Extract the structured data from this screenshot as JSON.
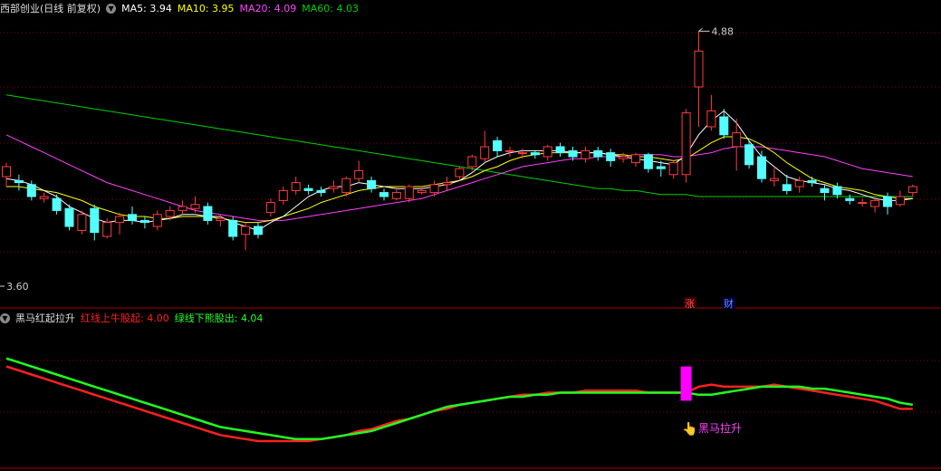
{
  "header1": {
    "title": "西部创业(日线 前复权)",
    "ma5_label": "MA5:",
    "ma5_value": "3.94",
    "ma10_label": "MA10:",
    "ma10_value": "3.95",
    "ma20_label": "MA20:",
    "ma20_value": "4.09",
    "ma60_label": "MA60:",
    "ma60_value": "4.03"
  },
  "header2": {
    "title": "黑马红起拉升",
    "red_label": "红线上牛股起:",
    "red_value": "4.00",
    "green_label": "绿线下熊股出:",
    "green_value": "4.04"
  },
  "annotations": {
    "high_label": "4.88",
    "low_label": "3.60",
    "zhang_badge": "涨",
    "cai_badge": "财",
    "signal_label": "黑马拉升"
  },
  "colors": {
    "up": "#ff3c3c",
    "down": "#54ffff",
    "ma5": "#ffffff",
    "ma10": "#ffff00",
    "ma20": "#ff40ff",
    "ma60": "#00d000",
    "red_line": "#ff2020",
    "green_line": "#20ff20",
    "signal_bar": "#ff00ff",
    "grid": "#8b0000"
  },
  "chart_data": {
    "type": "candlestick",
    "price_range": [
      3.5,
      4.95
    ],
    "high": 4.88,
    "low": 3.6,
    "candles": [
      [
        4.15,
        4.2,
        4.1,
        4.22
      ],
      [
        4.13,
        4.12,
        4.08,
        4.16
      ],
      [
        4.11,
        4.05,
        4.03,
        4.13
      ],
      [
        4.04,
        4.05,
        4.02,
        4.07
      ],
      [
        4.04,
        3.98,
        3.96,
        4.06
      ],
      [
        3.99,
        3.9,
        3.88,
        4.01
      ],
      [
        3.88,
        3.96,
        3.86,
        3.98
      ],
      [
        3.99,
        3.87,
        3.83,
        4.01
      ],
      [
        3.85,
        3.92,
        3.84,
        3.94
      ],
      [
        3.92,
        3.95,
        3.86,
        3.97
      ],
      [
        3.96,
        3.93,
        3.91,
        4.0
      ],
      [
        3.93,
        3.92,
        3.89,
        3.95
      ],
      [
        3.9,
        3.96,
        3.88,
        3.98
      ],
      [
        3.95,
        3.98,
        3.93,
        4.0
      ],
      [
        3.98,
        4.0,
        3.96,
        4.03
      ],
      [
        3.99,
        4.01,
        3.97,
        4.05
      ],
      [
        4.0,
        3.93,
        3.91,
        4.02
      ],
      [
        3.93,
        3.94,
        3.9,
        3.96
      ],
      [
        3.93,
        3.85,
        3.83,
        3.95
      ],
      [
        3.86,
        3.9,
        3.78,
        3.92
      ],
      [
        3.9,
        3.86,
        3.84,
        3.92
      ],
      [
        3.97,
        4.02,
        3.95,
        4.04
      ],
      [
        4.03,
        4.08,
        4.01,
        4.1
      ],
      [
        4.08,
        4.12,
        4.06,
        4.15
      ],
      [
        4.09,
        4.08,
        4.06,
        4.11
      ],
      [
        4.08,
        4.07,
        4.05,
        4.1
      ],
      [
        4.09,
        4.1,
        4.07,
        4.13
      ],
      [
        4.07,
        4.14,
        4.05,
        4.15
      ],
      [
        4.14,
        4.18,
        4.12,
        4.23
      ],
      [
        4.13,
        4.09,
        4.07,
        4.15
      ],
      [
        4.07,
        4.05,
        4.03,
        4.09
      ],
      [
        4.04,
        4.07,
        4.03,
        4.1
      ],
      [
        4.04,
        4.1,
        4.02,
        4.11
      ],
      [
        4.07,
        4.08,
        4.06,
        4.1
      ],
      [
        4.07,
        4.11,
        4.05,
        4.13
      ],
      [
        4.11,
        4.12,
        4.08,
        4.15
      ],
      [
        4.15,
        4.19,
        4.13,
        4.2
      ],
      [
        4.2,
        4.25,
        4.18,
        4.26
      ],
      [
        4.24,
        4.3,
        4.22,
        4.38
      ],
      [
        4.33,
        4.28,
        4.25,
        4.35
      ],
      [
        4.28,
        4.28,
        4.25,
        4.3
      ],
      [
        4.27,
        4.27,
        4.24,
        4.29
      ],
      [
        4.27,
        4.26,
        4.24,
        4.28
      ],
      [
        4.25,
        4.3,
        4.23,
        4.31
      ],
      [
        4.3,
        4.27,
        4.25,
        4.32
      ],
      [
        4.28,
        4.25,
        4.23,
        4.3
      ],
      [
        4.24,
        4.28,
        4.22,
        4.3
      ],
      [
        4.28,
        4.25,
        4.23,
        4.3
      ],
      [
        4.27,
        4.23,
        4.2,
        4.29
      ],
      [
        4.24,
        4.25,
        4.22,
        4.27
      ],
      [
        4.22,
        4.26,
        4.2,
        4.27
      ],
      [
        4.26,
        4.19,
        4.17,
        4.27
      ],
      [
        4.2,
        4.19,
        4.15,
        4.23
      ],
      [
        4.16,
        4.22,
        4.14,
        4.23
      ],
      [
        4.16,
        4.47,
        4.12,
        4.49
      ],
      [
        4.6,
        4.78,
        4.4,
        4.88
      ],
      [
        4.4,
        4.48,
        4.38,
        4.56
      ],
      [
        4.45,
        4.36,
        4.34,
        4.49
      ],
      [
        4.3,
        4.37,
        4.18,
        4.44
      ],
      [
        4.31,
        4.21,
        4.19,
        4.33
      ],
      [
        4.25,
        4.14,
        4.12,
        4.28
      ],
      [
        4.13,
        4.14,
        4.1,
        4.2
      ],
      [
        4.11,
        4.08,
        4.06,
        4.16
      ],
      [
        4.1,
        4.13,
        4.07,
        4.15
      ],
      [
        4.13,
        4.12,
        4.1,
        4.15
      ],
      [
        4.09,
        4.07,
        4.03,
        4.11
      ],
      [
        4.1,
        4.06,
        4.04,
        4.12
      ],
      [
        4.04,
        4.03,
        4.01,
        4.06
      ],
      [
        4.02,
        4.02,
        4.0,
        4.04
      ],
      [
        4.0,
        4.03,
        3.97,
        4.05
      ],
      [
        4.05,
        4.0,
        3.96,
        4.07
      ],
      [
        4.01,
        4.05,
        4.0,
        4.08
      ],
      [
        4.07,
        4.1,
        4.05,
        4.11
      ]
    ],
    "ma5": [
      4.14,
      4.13,
      4.11,
      4.08,
      4.05,
      4.0,
      3.97,
      3.94,
      3.92,
      3.93,
      3.93,
      3.92,
      3.93,
      3.94,
      3.96,
      3.96,
      3.95,
      3.95,
      3.92,
      3.9,
      3.88,
      3.92,
      3.95,
      4.0,
      4.05,
      4.08,
      4.1,
      4.1,
      4.12,
      4.11,
      4.1,
      4.09,
      4.09,
      4.09,
      4.1,
      4.11,
      4.13,
      4.17,
      4.22,
      4.25,
      4.27,
      4.28,
      4.28,
      4.28,
      4.28,
      4.27,
      4.27,
      4.27,
      4.26,
      4.25,
      4.24,
      4.23,
      4.22,
      4.21,
      4.26,
      4.36,
      4.43,
      4.48,
      4.42,
      4.33,
      4.25,
      4.2,
      4.15,
      4.13,
      4.12,
      4.11,
      4.09,
      4.08,
      4.06,
      4.04,
      4.03,
      4.03,
      4.04
    ],
    "ma10": [
      4.1,
      4.1,
      4.09,
      4.08,
      4.07,
      4.05,
      4.03,
      4.0,
      3.98,
      3.96,
      3.95,
      3.95,
      3.94,
      3.94,
      3.95,
      3.95,
      3.95,
      3.94,
      3.93,
      3.92,
      3.92,
      3.93,
      3.95,
      3.97,
      3.99,
      4.02,
      4.04,
      4.06,
      4.08,
      4.09,
      4.1,
      4.1,
      4.1,
      4.1,
      4.11,
      4.12,
      4.13,
      4.15,
      4.18,
      4.2,
      4.23,
      4.25,
      4.26,
      4.27,
      4.27,
      4.27,
      4.27,
      4.27,
      4.26,
      4.26,
      4.25,
      4.25,
      4.24,
      4.23,
      4.24,
      4.28,
      4.32,
      4.35,
      4.35,
      4.34,
      4.31,
      4.27,
      4.22,
      4.18,
      4.14,
      4.12,
      4.1,
      4.09,
      4.08,
      4.06,
      4.05,
      4.04,
      4.04
    ],
    "ma20": [
      4.36,
      4.33,
      4.3,
      4.27,
      4.24,
      4.21,
      4.18,
      4.15,
      4.12,
      4.1,
      4.08,
      4.06,
      4.04,
      4.02,
      4.0,
      3.98,
      3.97,
      3.96,
      3.95,
      3.94,
      3.93,
      3.93,
      3.93,
      3.94,
      3.95,
      3.96,
      3.97,
      3.98,
      3.99,
      4.0,
      4.01,
      4.02,
      4.03,
      4.04,
      4.06,
      4.08,
      4.1,
      4.12,
      4.14,
      4.16,
      4.18,
      4.2,
      4.21,
      4.22,
      4.23,
      4.24,
      4.24,
      4.25,
      4.25,
      4.25,
      4.26,
      4.26,
      4.26,
      4.25,
      4.25,
      4.26,
      4.27,
      4.29,
      4.3,
      4.3,
      4.3,
      4.29,
      4.28,
      4.27,
      4.26,
      4.25,
      4.23,
      4.21,
      4.19,
      4.18,
      4.17,
      4.16,
      4.15
    ],
    "ma60": [
      4.56,
      4.55,
      4.54,
      4.53,
      4.52,
      4.51,
      4.5,
      4.49,
      4.48,
      4.47,
      4.46,
      4.45,
      4.44,
      4.43,
      4.42,
      4.41,
      4.4,
      4.39,
      4.38,
      4.37,
      4.36,
      4.35,
      4.34,
      4.33,
      4.32,
      4.31,
      4.3,
      4.29,
      4.28,
      4.27,
      4.26,
      4.25,
      4.24,
      4.23,
      4.22,
      4.21,
      4.2,
      4.19,
      4.18,
      4.17,
      4.16,
      4.15,
      4.14,
      4.13,
      4.12,
      4.11,
      4.1,
      4.09,
      4.09,
      4.08,
      4.08,
      4.07,
      4.06,
      4.06,
      4.06,
      4.05,
      4.05,
      4.05,
      4.05,
      4.05,
      4.05,
      4.05,
      4.05,
      4.05,
      4.05,
      4.05,
      4.05,
      4.05,
      4.05,
      4.05,
      4.05,
      4.05,
      4.05
    ],
    "indicator_range": [
      3.7,
      4.4
    ],
    "red_line": [
      4.2,
      4.18,
      4.16,
      4.14,
      4.12,
      4.1,
      4.08,
      4.06,
      4.04,
      4.02,
      4.0,
      3.98,
      3.96,
      3.94,
      3.92,
      3.9,
      3.88,
      3.86,
      3.85,
      3.84,
      3.83,
      3.83,
      3.83,
      3.83,
      3.83,
      3.84,
      3.85,
      3.86,
      3.88,
      3.89,
      3.91,
      3.93,
      3.94,
      3.96,
      3.98,
      3.99,
      4.01,
      4.02,
      4.03,
      4.04,
      4.05,
      4.06,
      4.06,
      4.07,
      4.07,
      4.07,
      4.08,
      4.08,
      4.08,
      4.08,
      4.08,
      4.07,
      4.07,
      4.07,
      4.07,
      4.1,
      4.11,
      4.1,
      4.1,
      4.1,
      4.1,
      4.11,
      4.1,
      4.09,
      4.08,
      4.07,
      4.06,
      4.05,
      4.04,
      4.03,
      4.01,
      3.99,
      3.99
    ],
    "green_line": [
      4.24,
      4.22,
      4.2,
      4.18,
      4.16,
      4.14,
      4.12,
      4.1,
      4.08,
      4.06,
      4.04,
      4.02,
      4.0,
      3.98,
      3.96,
      3.94,
      3.92,
      3.9,
      3.89,
      3.88,
      3.87,
      3.86,
      3.85,
      3.84,
      3.84,
      3.84,
      3.85,
      3.86,
      3.87,
      3.88,
      3.9,
      3.92,
      3.94,
      3.96,
      3.98,
      4.0,
      4.01,
      4.02,
      4.03,
      4.04,
      4.05,
      4.05,
      4.06,
      4.06,
      4.07,
      4.07,
      4.07,
      4.07,
      4.07,
      4.07,
      4.07,
      4.07,
      4.07,
      4.07,
      4.07,
      4.06,
      4.06,
      4.07,
      4.08,
      4.09,
      4.1,
      4.1,
      4.1,
      4.1,
      4.09,
      4.09,
      4.08,
      4.07,
      4.06,
      4.05,
      4.04,
      4.02,
      4.01
    ],
    "signal": {
      "index": 54,
      "from": 4.03,
      "to": 4.2
    }
  }
}
